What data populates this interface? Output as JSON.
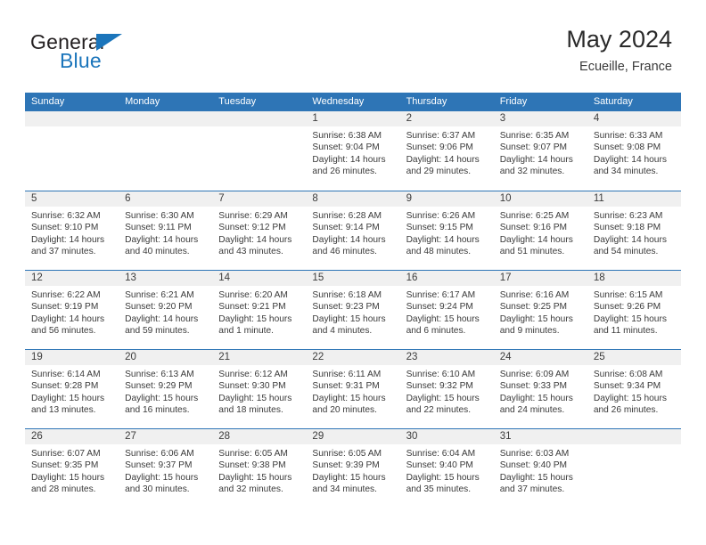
{
  "brand": {
    "name_part1": "General",
    "name_part2": "Blue",
    "logo_icon": "triangle-icon"
  },
  "header": {
    "title": "May 2024",
    "location": "Ecueille, France"
  },
  "calendar": {
    "accent_color": "#2e75b6",
    "daynum_band_color": "#f0f0f0",
    "day_headers": [
      "Sunday",
      "Monday",
      "Tuesday",
      "Wednesday",
      "Thursday",
      "Friday",
      "Saturday"
    ],
    "weeks": [
      [
        {
          "day": "",
          "empty": true
        },
        {
          "day": "",
          "empty": true
        },
        {
          "day": "",
          "empty": true
        },
        {
          "day": "1",
          "sunrise": "Sunrise: 6:38 AM",
          "sunset": "Sunset: 9:04 PM",
          "daylight": "Daylight: 14 hours and 26 minutes."
        },
        {
          "day": "2",
          "sunrise": "Sunrise: 6:37 AM",
          "sunset": "Sunset: 9:06 PM",
          "daylight": "Daylight: 14 hours and 29 minutes."
        },
        {
          "day": "3",
          "sunrise": "Sunrise: 6:35 AM",
          "sunset": "Sunset: 9:07 PM",
          "daylight": "Daylight: 14 hours and 32 minutes."
        },
        {
          "day": "4",
          "sunrise": "Sunrise: 6:33 AM",
          "sunset": "Sunset: 9:08 PM",
          "daylight": "Daylight: 14 hours and 34 minutes."
        }
      ],
      [
        {
          "day": "5",
          "sunrise": "Sunrise: 6:32 AM",
          "sunset": "Sunset: 9:10 PM",
          "daylight": "Daylight: 14 hours and 37 minutes."
        },
        {
          "day": "6",
          "sunrise": "Sunrise: 6:30 AM",
          "sunset": "Sunset: 9:11 PM",
          "daylight": "Daylight: 14 hours and 40 minutes."
        },
        {
          "day": "7",
          "sunrise": "Sunrise: 6:29 AM",
          "sunset": "Sunset: 9:12 PM",
          "daylight": "Daylight: 14 hours and 43 minutes."
        },
        {
          "day": "8",
          "sunrise": "Sunrise: 6:28 AM",
          "sunset": "Sunset: 9:14 PM",
          "daylight": "Daylight: 14 hours and 46 minutes."
        },
        {
          "day": "9",
          "sunrise": "Sunrise: 6:26 AM",
          "sunset": "Sunset: 9:15 PM",
          "daylight": "Daylight: 14 hours and 48 minutes."
        },
        {
          "day": "10",
          "sunrise": "Sunrise: 6:25 AM",
          "sunset": "Sunset: 9:16 PM",
          "daylight": "Daylight: 14 hours and 51 minutes."
        },
        {
          "day": "11",
          "sunrise": "Sunrise: 6:23 AM",
          "sunset": "Sunset: 9:18 PM",
          "daylight": "Daylight: 14 hours and 54 minutes."
        }
      ],
      [
        {
          "day": "12",
          "sunrise": "Sunrise: 6:22 AM",
          "sunset": "Sunset: 9:19 PM",
          "daylight": "Daylight: 14 hours and 56 minutes."
        },
        {
          "day": "13",
          "sunrise": "Sunrise: 6:21 AM",
          "sunset": "Sunset: 9:20 PM",
          "daylight": "Daylight: 14 hours and 59 minutes."
        },
        {
          "day": "14",
          "sunrise": "Sunrise: 6:20 AM",
          "sunset": "Sunset: 9:21 PM",
          "daylight": "Daylight: 15 hours and 1 minute."
        },
        {
          "day": "15",
          "sunrise": "Sunrise: 6:18 AM",
          "sunset": "Sunset: 9:23 PM",
          "daylight": "Daylight: 15 hours and 4 minutes."
        },
        {
          "day": "16",
          "sunrise": "Sunrise: 6:17 AM",
          "sunset": "Sunset: 9:24 PM",
          "daylight": "Daylight: 15 hours and 6 minutes."
        },
        {
          "day": "17",
          "sunrise": "Sunrise: 6:16 AM",
          "sunset": "Sunset: 9:25 PM",
          "daylight": "Daylight: 15 hours and 9 minutes."
        },
        {
          "day": "18",
          "sunrise": "Sunrise: 6:15 AM",
          "sunset": "Sunset: 9:26 PM",
          "daylight": "Daylight: 15 hours and 11 minutes."
        }
      ],
      [
        {
          "day": "19",
          "sunrise": "Sunrise: 6:14 AM",
          "sunset": "Sunset: 9:28 PM",
          "daylight": "Daylight: 15 hours and 13 minutes."
        },
        {
          "day": "20",
          "sunrise": "Sunrise: 6:13 AM",
          "sunset": "Sunset: 9:29 PM",
          "daylight": "Daylight: 15 hours and 16 minutes."
        },
        {
          "day": "21",
          "sunrise": "Sunrise: 6:12 AM",
          "sunset": "Sunset: 9:30 PM",
          "daylight": "Daylight: 15 hours and 18 minutes."
        },
        {
          "day": "22",
          "sunrise": "Sunrise: 6:11 AM",
          "sunset": "Sunset: 9:31 PM",
          "daylight": "Daylight: 15 hours and 20 minutes."
        },
        {
          "day": "23",
          "sunrise": "Sunrise: 6:10 AM",
          "sunset": "Sunset: 9:32 PM",
          "daylight": "Daylight: 15 hours and 22 minutes."
        },
        {
          "day": "24",
          "sunrise": "Sunrise: 6:09 AM",
          "sunset": "Sunset: 9:33 PM",
          "daylight": "Daylight: 15 hours and 24 minutes."
        },
        {
          "day": "25",
          "sunrise": "Sunrise: 6:08 AM",
          "sunset": "Sunset: 9:34 PM",
          "daylight": "Daylight: 15 hours and 26 minutes."
        }
      ],
      [
        {
          "day": "26",
          "sunrise": "Sunrise: 6:07 AM",
          "sunset": "Sunset: 9:35 PM",
          "daylight": "Daylight: 15 hours and 28 minutes."
        },
        {
          "day": "27",
          "sunrise": "Sunrise: 6:06 AM",
          "sunset": "Sunset: 9:37 PM",
          "daylight": "Daylight: 15 hours and 30 minutes."
        },
        {
          "day": "28",
          "sunrise": "Sunrise: 6:05 AM",
          "sunset": "Sunset: 9:38 PM",
          "daylight": "Daylight: 15 hours and 32 minutes."
        },
        {
          "day": "29",
          "sunrise": "Sunrise: 6:05 AM",
          "sunset": "Sunset: 9:39 PM",
          "daylight": "Daylight: 15 hours and 34 minutes."
        },
        {
          "day": "30",
          "sunrise": "Sunrise: 6:04 AM",
          "sunset": "Sunset: 9:40 PM",
          "daylight": "Daylight: 15 hours and 35 minutes."
        },
        {
          "day": "31",
          "sunrise": "Sunrise: 6:03 AM",
          "sunset": "Sunset: 9:40 PM",
          "daylight": "Daylight: 15 hours and 37 minutes."
        },
        {
          "day": "",
          "empty": true
        }
      ]
    ]
  }
}
